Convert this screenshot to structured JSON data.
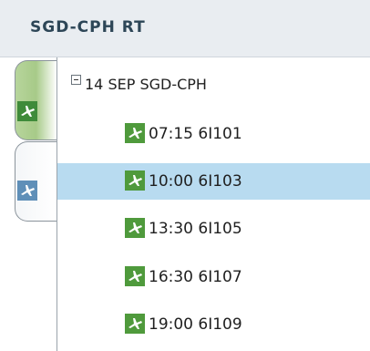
{
  "header": {
    "title": "SGD-CPH RT"
  },
  "tabs": [
    {
      "icon": "plane-icon",
      "active": true
    },
    {
      "icon": "plane-icon",
      "active": false
    }
  ],
  "tree": {
    "root_label": "14 SEP SGD-CPH",
    "expanded": true,
    "flights": [
      {
        "label": "07:15 6I101",
        "selected": false
      },
      {
        "label": "10:00 6I103",
        "selected": true
      },
      {
        "label": "13:30 6I105",
        "selected": false
      },
      {
        "label": "16:30 6I107",
        "selected": false
      },
      {
        "label": "19:00 6I109",
        "selected": false
      }
    ]
  },
  "colors": {
    "active_tab": "#a7ca88",
    "selection": "#b8dbf0",
    "flight_icon_bg": "#4f9a3c",
    "header_bg": "#e9edf1"
  }
}
